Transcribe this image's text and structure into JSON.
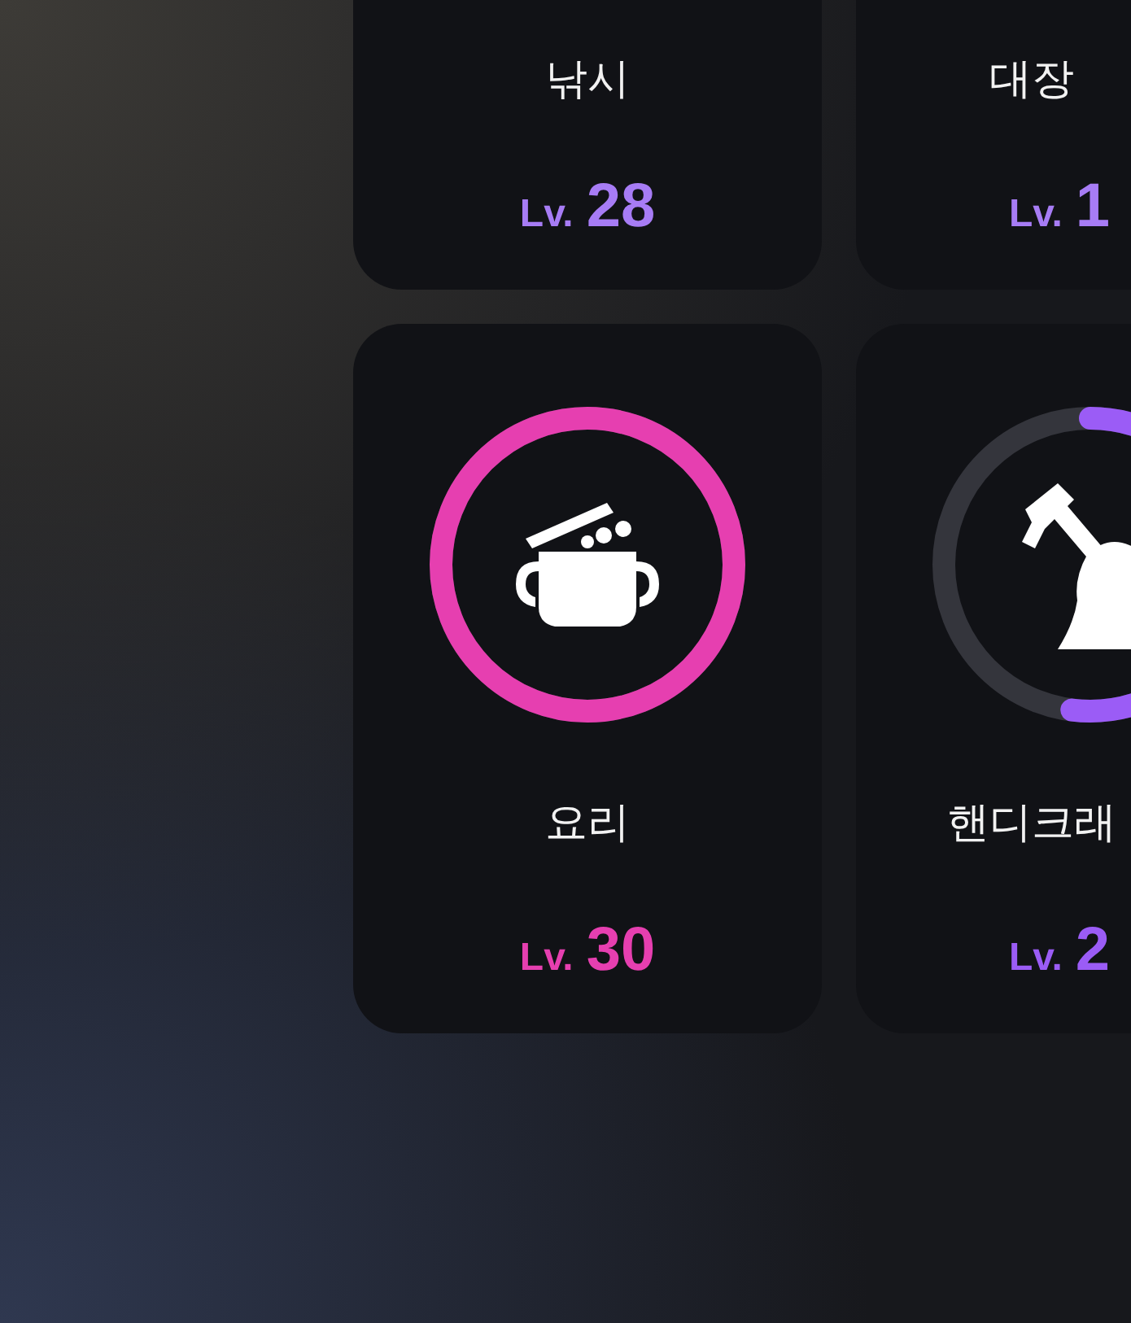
{
  "skills": [
    {
      "name": "낚시",
      "lv_label": "Lv.",
      "lv_value": "28",
      "color": "#a77cf5"
    },
    {
      "name": "대장",
      "lv_label": "Lv.",
      "lv_value": "1",
      "color": "#a77cf5"
    },
    {
      "name": "요리",
      "lv_label": "Lv.",
      "lv_value": "30",
      "color": "#e63fb0"
    },
    {
      "name": "핸디크래",
      "lv_label": "Lv.",
      "lv_value": "2",
      "color": "#9b5cf6"
    }
  ]
}
